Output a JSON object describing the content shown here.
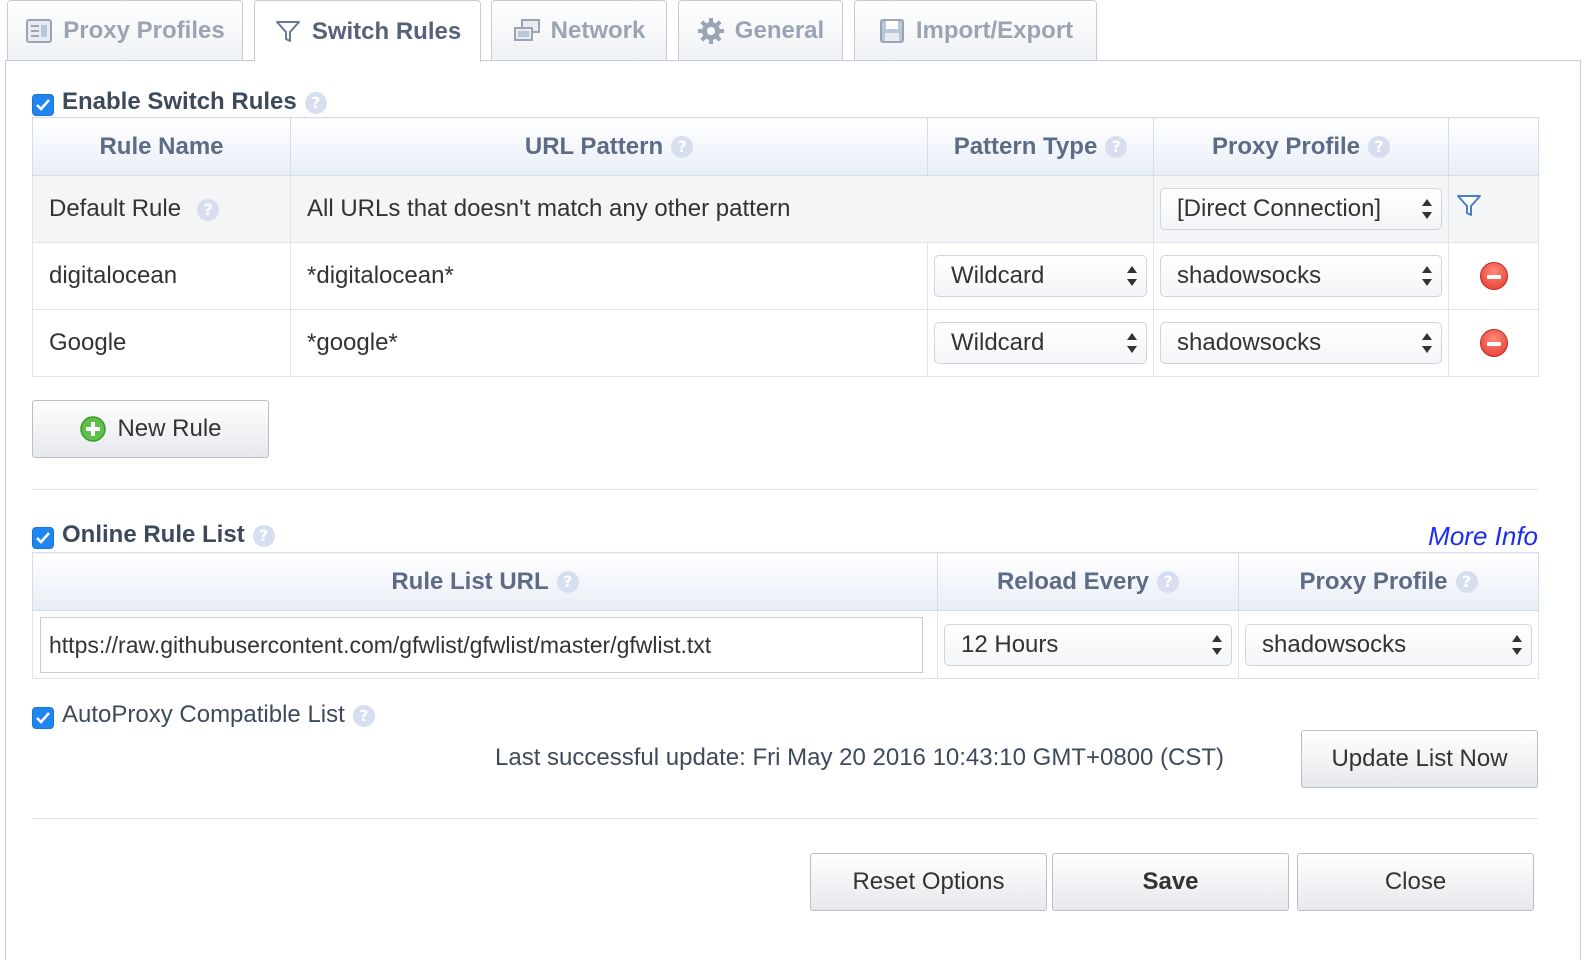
{
  "tabs": [
    {
      "label": "Proxy Profiles",
      "icon": "profiles-icon"
    },
    {
      "label": "Switch Rules",
      "icon": "funnel-icon",
      "active": true
    },
    {
      "label": "Network",
      "icon": "network-icon"
    },
    {
      "label": "General",
      "icon": "gear-icon"
    },
    {
      "label": "Import/Export",
      "icon": "floppy-disk-icon"
    }
  ],
  "switch_rules": {
    "enabled": true,
    "label": "Enable Switch Rules",
    "columns": {
      "rule_name": "Rule Name",
      "url_pattern": "URL Pattern",
      "pattern_type": "Pattern Type",
      "proxy_profile": "Proxy Profile"
    },
    "default_rule": {
      "name": "Default Rule",
      "description": "All URLs that doesn't match any other pattern",
      "profile": "[Direct Connection]"
    },
    "rules": [
      {
        "name": "digitalocean",
        "pattern": "*digitalocean*",
        "type": "Wildcard",
        "profile": "shadowsocks"
      },
      {
        "name": "Google",
        "pattern": "*google*",
        "type": "Wildcard",
        "profile": "shadowsocks"
      }
    ],
    "new_rule_label": "New Rule"
  },
  "online_rule_list": {
    "enabled": true,
    "label": "Online Rule List",
    "more_info": "More Info",
    "columns": {
      "url": "Rule List URL",
      "reload": "Reload Every",
      "profile": "Proxy Profile"
    },
    "url": "https://raw.githubusercontent.com/gfwlist/gfwlist/master/gfwlist.txt",
    "reload_every": "12 Hours",
    "profile": "shadowsocks",
    "autoproxy_enabled": true,
    "autoproxy_label": "AutoProxy Compatible List",
    "last_update": "Last successful update: Fri May 20 2016 10:43:10 GMT+0800 (CST)",
    "update_button": "Update List Now"
  },
  "footer": {
    "reset": "Reset Options",
    "save": "Save",
    "close": "Close"
  },
  "colors": {
    "checkbox": "#1f86f1",
    "link": "#1a2ef0",
    "remove": "#e3342a",
    "header_text": "#5d6b85"
  }
}
